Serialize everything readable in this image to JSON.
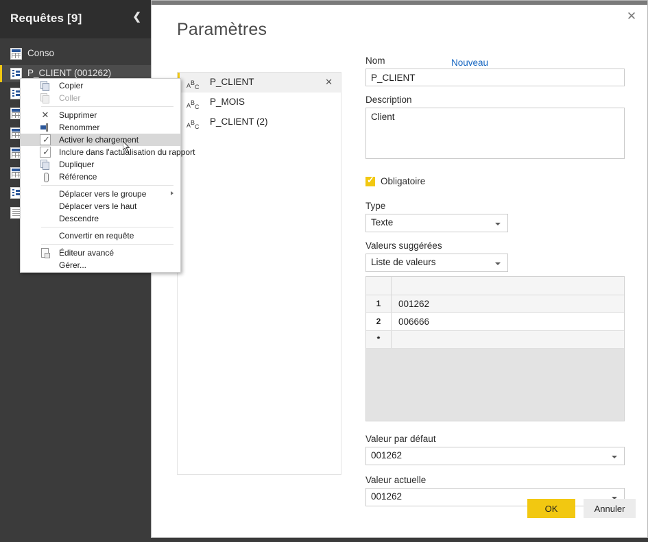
{
  "sidebar": {
    "title": "Requêtes [9]",
    "collapse_icon": "chevron-left-icon",
    "items": [
      {
        "label": "Conso",
        "icon": "table-icon",
        "selected": false
      },
      {
        "label": "P_CLIENT (001262)",
        "icon": "parameter-icon",
        "selected": true
      },
      {
        "label": "",
        "icon": "parameter-icon",
        "selected": false
      },
      {
        "label": "",
        "icon": "table-icon",
        "selected": false
      },
      {
        "label": "",
        "icon": "table-icon",
        "selected": false
      },
      {
        "label": "",
        "icon": "table-icon",
        "selected": false
      },
      {
        "label": "",
        "icon": "table-icon",
        "selected": false
      },
      {
        "label": "",
        "icon": "parameter-icon",
        "selected": false
      },
      {
        "label": "",
        "icon": "list-icon",
        "selected": false
      }
    ]
  },
  "context_menu": {
    "items": [
      {
        "label": "Copier",
        "icon": "copy-icon",
        "disabled": false,
        "highlighted": false,
        "separator_after": false,
        "submenu": false
      },
      {
        "label": "Coller",
        "icon": "paste-icon",
        "disabled": true,
        "highlighted": false,
        "separator_after": true,
        "submenu": false
      },
      {
        "label": "Supprimer",
        "icon": "delete-x-icon",
        "disabled": false,
        "highlighted": false,
        "separator_after": false,
        "submenu": false
      },
      {
        "label": "Renommer",
        "icon": "rename-icon",
        "disabled": false,
        "highlighted": false,
        "separator_after": false,
        "submenu": false
      },
      {
        "label": "Activer le chargement",
        "icon": "checkbox-checked-icon",
        "disabled": false,
        "highlighted": true,
        "separator_after": false,
        "submenu": false
      },
      {
        "label": "Inclure dans l'actualisation du rapport",
        "icon": "checkbox-checked-icon",
        "disabled": false,
        "highlighted": false,
        "separator_after": false,
        "submenu": false
      },
      {
        "label": "Dupliquer",
        "icon": "copy-icon",
        "disabled": false,
        "highlighted": false,
        "separator_after": false,
        "submenu": false
      },
      {
        "label": "Référence",
        "icon": "paperclip-icon",
        "disabled": false,
        "highlighted": false,
        "separator_after": true,
        "submenu": false
      },
      {
        "label": "Déplacer vers le groupe",
        "icon": "",
        "disabled": false,
        "highlighted": false,
        "separator_after": false,
        "submenu": true
      },
      {
        "label": "Déplacer vers le haut",
        "icon": "",
        "disabled": false,
        "highlighted": false,
        "separator_after": false,
        "submenu": false
      },
      {
        "label": "Descendre",
        "icon": "",
        "disabled": false,
        "highlighted": false,
        "separator_after": true,
        "submenu": false
      },
      {
        "label": "Convertir en requête",
        "icon": "",
        "disabled": false,
        "highlighted": false,
        "separator_after": true,
        "submenu": false
      },
      {
        "label": "Éditeur avancé",
        "icon": "advanced-editor-icon",
        "disabled": false,
        "highlighted": false,
        "separator_after": false,
        "submenu": false
      },
      {
        "label": "Gérer...",
        "icon": "",
        "disabled": false,
        "highlighted": false,
        "separator_after": false,
        "submenu": false
      }
    ]
  },
  "dialog": {
    "title": "Paramètres",
    "close_icon": "close-icon",
    "new_link": "Nouveau",
    "parameters": [
      {
        "name": "P_CLIENT",
        "type_icon": "abc-text-icon",
        "selected": true,
        "deletable": true
      },
      {
        "name": "P_MOIS",
        "type_icon": "abc-text-icon",
        "selected": false,
        "deletable": false
      },
      {
        "name": "P_CLIENT (2)",
        "type_icon": "abc-text-icon",
        "selected": false,
        "deletable": false
      }
    ],
    "form": {
      "name_label": "Nom",
      "name_value": "P_CLIENT",
      "description_label": "Description",
      "description_value": "Client",
      "required_label": "Obligatoire",
      "required_checked": true,
      "type_label": "Type",
      "type_value": "Texte",
      "suggested_label": "Valeurs suggérées",
      "suggested_value": "Liste de valeurs",
      "values_grid": {
        "rows": [
          {
            "index": "1",
            "value": "001262"
          },
          {
            "index": "2",
            "value": "006666"
          },
          {
            "index": "*",
            "value": ""
          }
        ]
      },
      "default_label": "Valeur par défaut",
      "default_value": "001262",
      "current_label": "Valeur actuelle",
      "current_value": "001262"
    },
    "buttons": {
      "ok": "OK",
      "cancel": "Annuler"
    }
  },
  "colors": {
    "accent_yellow": "#f2c811",
    "sidebar_bg": "#3b3b3b",
    "sidebar_header_bg": "#2e2e2e",
    "link_blue": "#1565c0",
    "cancel_gray": "#ececec"
  }
}
